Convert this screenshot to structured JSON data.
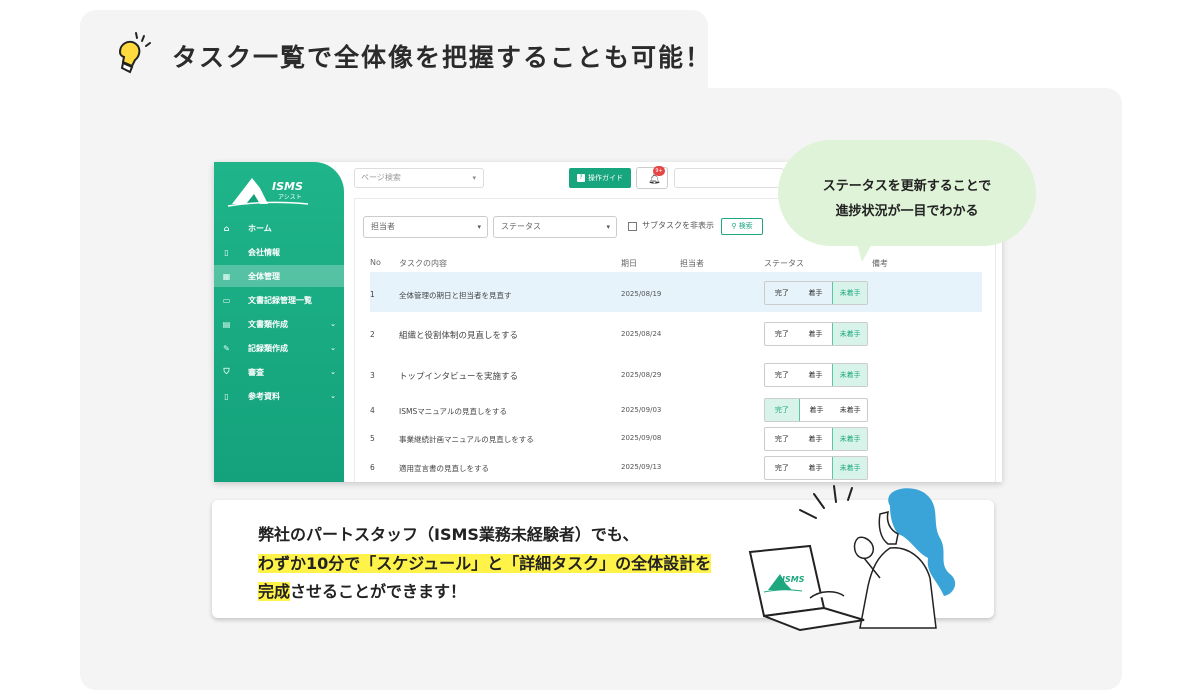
{
  "heading": {
    "title": "タスク一覧で全体像を把握することも可能！",
    "icon": "lightbulb-icon"
  },
  "app": {
    "sidebar": {
      "logo_text": "ISMS",
      "logo_sub": "アシスト",
      "items": [
        {
          "label": "ホーム",
          "icon": "home-icon",
          "chevron": false
        },
        {
          "label": "会社情報",
          "icon": "building-icon",
          "chevron": false
        },
        {
          "label": "全体管理",
          "icon": "grid-icon",
          "chevron": false,
          "active": true
        },
        {
          "label": "文書記録管理一覧",
          "icon": "folder-icon",
          "chevron": false
        },
        {
          "label": "文書類作成",
          "icon": "document-icon",
          "chevron": true
        },
        {
          "label": "記録類作成",
          "icon": "pencil-icon",
          "chevron": true
        },
        {
          "label": "審査",
          "icon": "shield-check-icon",
          "chevron": true
        },
        {
          "label": "参考資料",
          "icon": "book-icon",
          "chevron": true
        }
      ]
    },
    "topbar": {
      "page_search_placeholder": "ページ検索",
      "guide_label": "操作ガイド",
      "notification_badge": "9+"
    },
    "filters": {
      "assignee_placeholder": "担当者",
      "status_placeholder": "ステータス",
      "hide_subtasks_label": "サブタスクを非表示",
      "search_label": "検索"
    },
    "table": {
      "headers": [
        "No",
        "タスクの内容",
        "期日",
        "担当者",
        "ステータス",
        "備考"
      ],
      "status_options": [
        "完了",
        "着手",
        "未着手"
      ],
      "rows": [
        {
          "no": "1",
          "task": "全体管理の期日と担当者を見直す",
          "due": "2025/08/19",
          "status": "未着手"
        },
        {
          "no": "2",
          "task": "組織と役割体制の見直しをする",
          "due": "2025/08/24",
          "status": "未着手"
        },
        {
          "no": "3",
          "task": "トップインタビューを実施する",
          "due": "2025/08/29",
          "status": "未着手"
        },
        {
          "no": "4",
          "task": "ISMSマニュアルの見直しをする",
          "due": "2025/09/03",
          "status": "完了"
        },
        {
          "no": "5",
          "task": "事業継続計画マニュアルの見直しをする",
          "due": "2025/09/08",
          "status": "未着手"
        },
        {
          "no": "6",
          "task": "適用宣言書の見直しをする",
          "due": "2025/09/13",
          "status": "未着手"
        }
      ]
    }
  },
  "bubble": {
    "line1": "ステータスを更新することで",
    "line2": "進捗状況が一目でわかる"
  },
  "note": {
    "line1": "弊社のパートスタッフ（ISMS業務未経験者）でも、",
    "line2": "わずか10分で「スケジュール」と「詳細タスク」の全体設計を",
    "line3_hl": "完成",
    "line3_rest": "させることができます！"
  },
  "colors": {
    "brand_green": "#16a57d",
    "bubble_green": "#def3d7",
    "highlight_yellow": "#fff34a",
    "row_selected": "#e6f3fb"
  }
}
